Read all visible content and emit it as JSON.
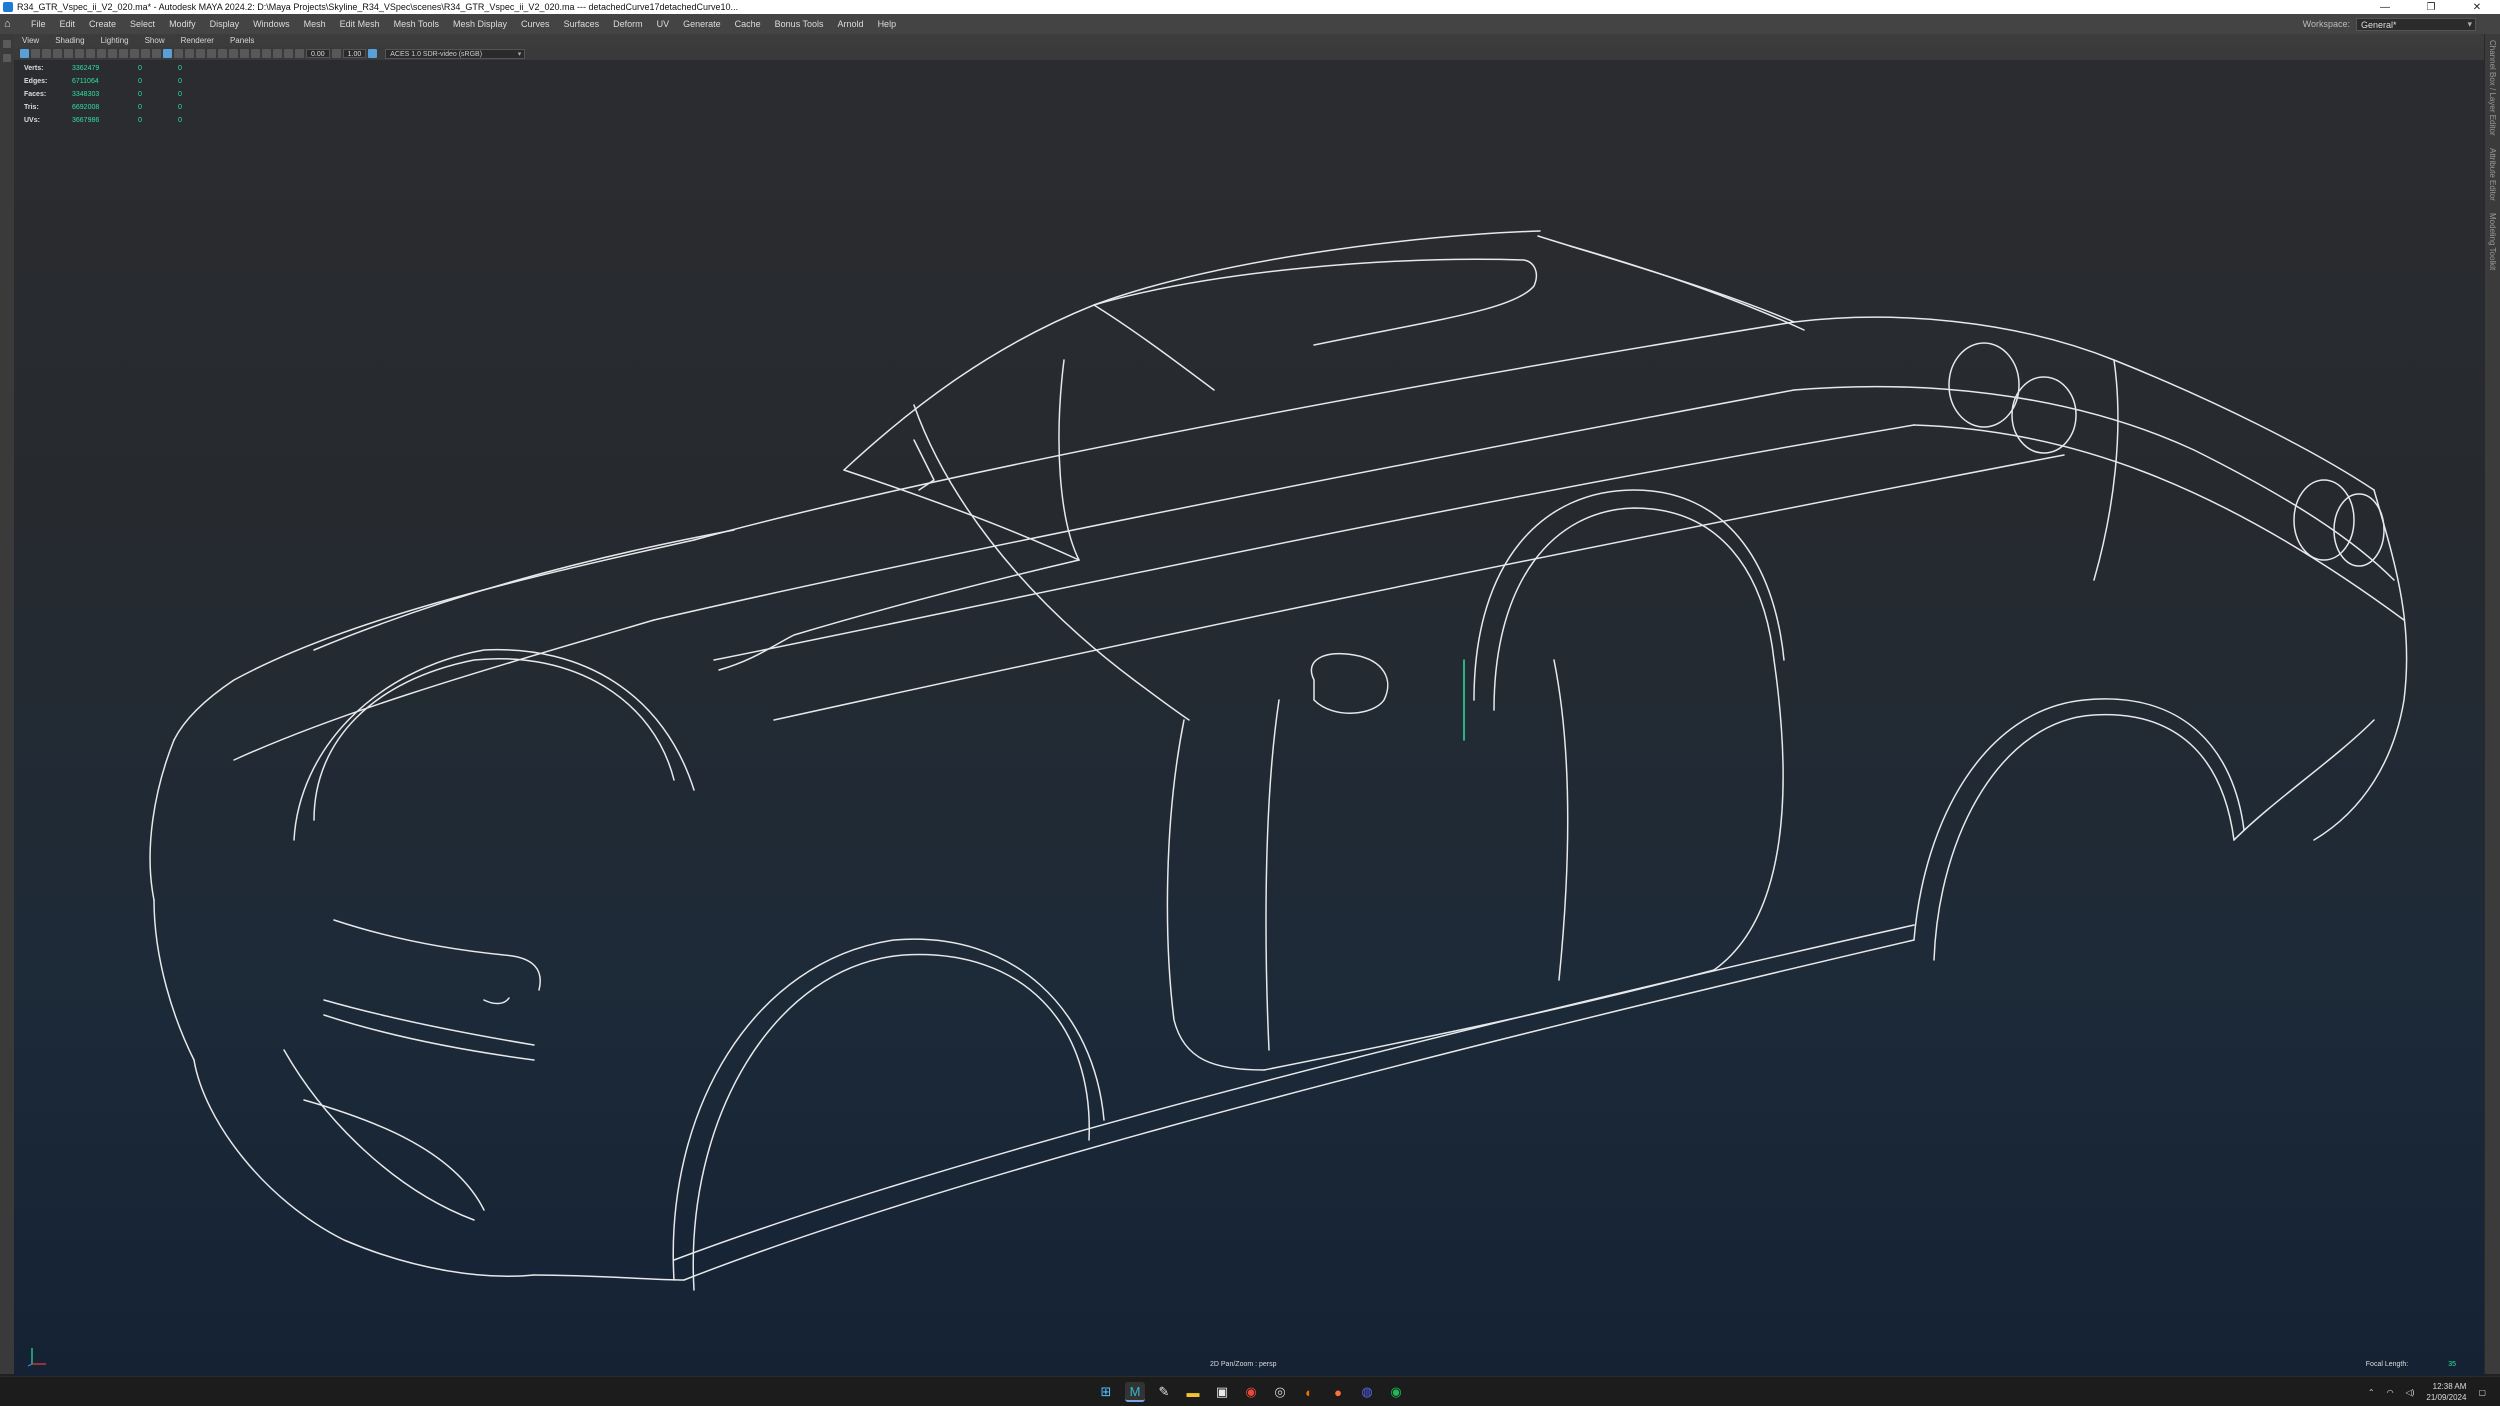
{
  "window": {
    "title": "R34_GTR_Vspec_ii_V2_020.ma* - Autodesk MAYA 2024.2: D:\\Maya Projects\\Skyline_R34_VSpec\\scenes\\R34_GTR_Vspec_ii_V2_020.ma  ---  detachedCurve17detachedCurve10...",
    "controls": [
      "—",
      "❐",
      "✕"
    ]
  },
  "menubar": {
    "items": [
      "File",
      "Edit",
      "Create",
      "Select",
      "Modify",
      "Display",
      "Windows",
      "Mesh",
      "Edit Mesh",
      "Mesh Tools",
      "Mesh Display",
      "Curves",
      "Surfaces",
      "Deform",
      "UV",
      "Generate",
      "Cache",
      "Bonus Tools",
      "Arnold",
      "Help"
    ],
    "workspace_label": "Workspace:",
    "workspace_value": "General*"
  },
  "panel_menu": [
    "View",
    "Shading",
    "Lighting",
    "Show",
    "Renderer",
    "Panels"
  ],
  "toolbar": {
    "field_a": "0.00",
    "field_b": "1.00",
    "color_space": "ACES 1.0 SDR-video (sRGB)"
  },
  "hud": {
    "rows": [
      {
        "label": "Verts:",
        "value": "3362479",
        "sel": "0",
        "comp": "0"
      },
      {
        "label": "Edges:",
        "value": "6711064",
        "sel": "0",
        "comp": "0"
      },
      {
        "label": "Faces:",
        "value": "3348303",
        "sel": "0",
        "comp": "0"
      },
      {
        "label": "Tris:",
        "value": "6692008",
        "sel": "0",
        "comp": "0"
      },
      {
        "label": "UVs:",
        "value": "3667986",
        "sel": "0",
        "comp": "0"
      }
    ]
  },
  "viewport": {
    "camera_label": "2D Pan/Zoom : persp",
    "focal_label": "Focal Length:",
    "focal_value": "35"
  },
  "right_panel_tabs": [
    "Channel Box / Layer Editor",
    "Attribute Editor",
    "Modeling Toolkit"
  ],
  "taskbar": {
    "apps": [
      {
        "icon": "windows-start-icon",
        "glyph": "⊞",
        "color": "#4cc2ff"
      },
      {
        "icon": "maya-icon",
        "glyph": "M",
        "color": "#35b6c9"
      },
      {
        "icon": "inkscape-icon",
        "glyph": "✎",
        "color": "#e6e6e6"
      },
      {
        "icon": "folder-icon",
        "glyph": "▬",
        "color": "#f1c232"
      },
      {
        "icon": "file-icon",
        "glyph": "▣",
        "color": "#e9e9e9"
      },
      {
        "icon": "chrome-icon",
        "glyph": "◉",
        "color": "#e8493b"
      },
      {
        "icon": "steam-icon",
        "glyph": "◎",
        "color": "#cfd8e3"
      },
      {
        "icon": "blender-icon",
        "glyph": "◐",
        "color": "#ea7600"
      },
      {
        "icon": "firefox-icon",
        "glyph": "●",
        "color": "#ff7139"
      },
      {
        "icon": "discord-icon",
        "glyph": "◍",
        "color": "#5865f2"
      },
      {
        "icon": "spotify-icon",
        "glyph": "◉",
        "color": "#1db954"
      }
    ],
    "time": "12:38 AM",
    "date": "21/09/2024"
  }
}
